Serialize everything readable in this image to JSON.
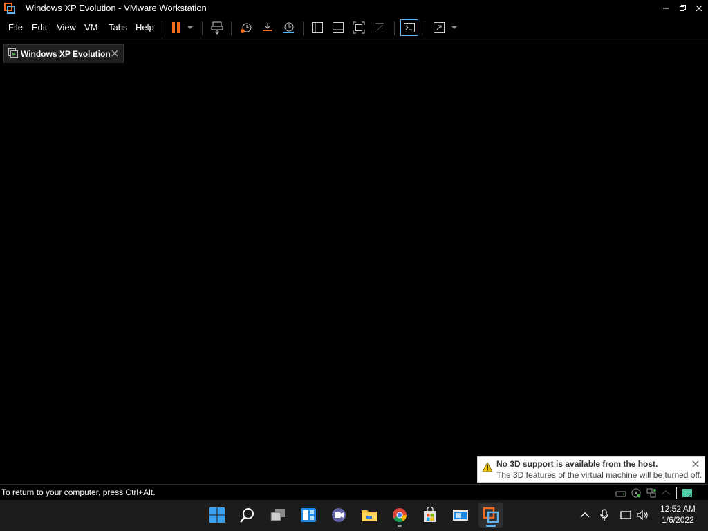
{
  "window": {
    "title": "Windows XP Evolution - VMware Workstation"
  },
  "menu": {
    "items": [
      "File",
      "Edit",
      "View",
      "VM",
      "Tabs",
      "Help"
    ]
  },
  "tab": {
    "label": "Windows XP Evolution"
  },
  "notification": {
    "title": "No 3D support is available from the host.",
    "body": "The 3D features of the virtual machine will be turned off."
  },
  "status": {
    "text": "To return to your computer, press Ctrl+Alt."
  },
  "taskbar": {
    "time": "12:52 AM",
    "date": "1/6/2022"
  },
  "colors": {
    "pause_orange": "#f26b21",
    "accent_blue": "#5fb2f0",
    "warning_yellow": "#f2c511"
  }
}
